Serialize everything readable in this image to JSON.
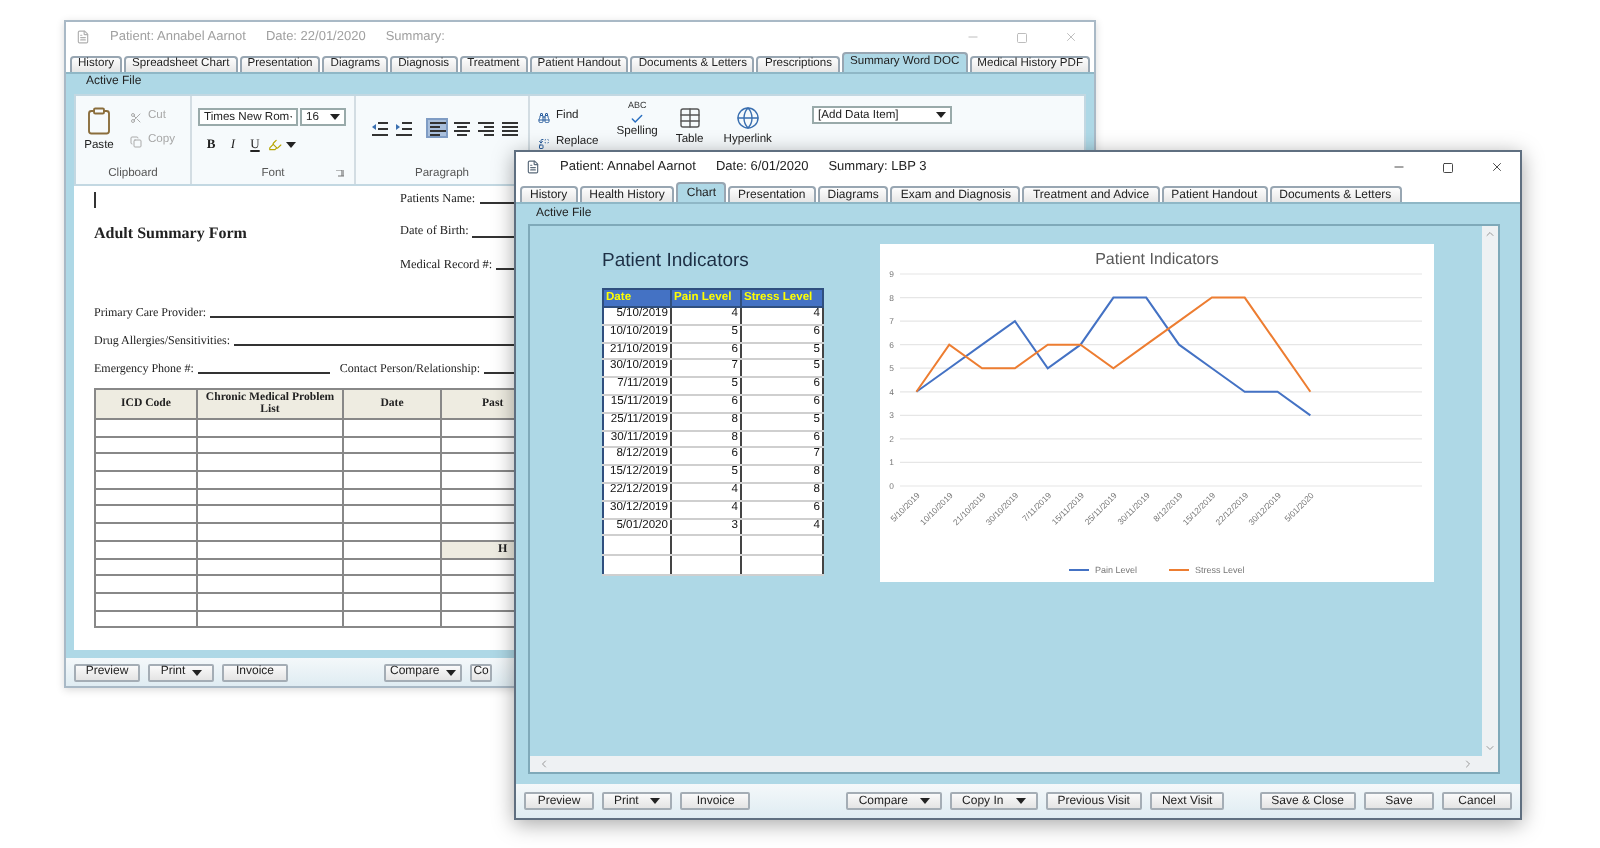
{
  "back_window": {
    "active": false,
    "title": [
      "Patient: Annabel Aarnot",
      "Date: 22/01/2020",
      "Summary:"
    ],
    "tabs": [
      {
        "label": "History",
        "selected": false
      },
      {
        "label": "Spreadsheet Chart",
        "selected": false
      },
      {
        "label": "Presentation",
        "selected": false
      },
      {
        "label": "Diagrams",
        "selected": false
      },
      {
        "label": "Diagnosis",
        "selected": false
      },
      {
        "label": "Treatment",
        "selected": false
      },
      {
        "label": "Patient Handout",
        "selected": false
      },
      {
        "label": "Documents & Letters",
        "selected": false
      },
      {
        "label": "Prescriptions",
        "selected": false
      },
      {
        "label": "Summary Word DOC",
        "selected": true
      },
      {
        "label": "Medical History PDF",
        "selected": false
      }
    ],
    "section_label": "Active File",
    "ribbon": {
      "clipboard": {
        "paste": "Paste",
        "cut": {
          "label": "Cut",
          "disabled": true
        },
        "copy": {
          "label": "Copy",
          "disabled": true
        },
        "group_label": "Clipboard"
      },
      "font": {
        "family": "Times New Rom",
        "size": "16",
        "bold": "B",
        "italic": "I",
        "underline": "U",
        "group_label": "Font"
      },
      "paragraph": {
        "alignments": [
          {
            "kind": "left",
            "selected": true
          },
          {
            "kind": "center",
            "selected": false
          },
          {
            "kind": "right",
            "selected": false
          },
          {
            "kind": "justify",
            "selected": false
          }
        ],
        "group_label": "Paragraph"
      },
      "find": "Find",
      "replace": "Replace",
      "spelling": {
        "mark": "ABC",
        "label": "Spelling"
      },
      "table": "Table",
      "hyperlink": "Hyperlink",
      "data_item": "[Add Data Item]"
    },
    "document": {
      "title": "Adult Summary Form",
      "header_fields": [
        "Patients Name:",
        "Date of Birth:",
        "Medical Record #:"
      ],
      "lines": [
        [
          "Primary Care Provider:"
        ],
        [
          "Drug Allergies/Sensitivities:"
        ],
        [
          "Emergency Phone #:",
          "Contact Person/Relationship:"
        ]
      ],
      "table": {
        "columns": [
          "ICD Code",
          "Chronic Medical Problem List",
          "Date",
          "Past"
        ],
        "section_row": "H"
      }
    },
    "buttons": {
      "left": [
        {
          "label": "Preview",
          "dropdown": false
        },
        {
          "label": "Print",
          "dropdown": true
        },
        {
          "label": "Invoice",
          "dropdown": false
        }
      ],
      "middle": [
        {
          "label": "Compare",
          "dropdown": true
        },
        {
          "label": "Co",
          "dropdown": false
        }
      ]
    }
  },
  "front_window": {
    "active": true,
    "title": [
      "Patient: Annabel Aarnot",
      "Date: 6/01/2020",
      "Summary: LBP 3"
    ],
    "tabs": [
      {
        "label": "History",
        "selected": false
      },
      {
        "label": "Health History",
        "selected": false
      },
      {
        "label": "Chart",
        "selected": true
      },
      {
        "label": "Presentation",
        "selected": false
      },
      {
        "label": "Diagrams",
        "selected": false
      },
      {
        "label": "Exam and Diagnosis",
        "selected": false
      },
      {
        "label": "Treatment and Advice",
        "selected": false
      },
      {
        "label": "Patient Handout",
        "selected": false
      },
      {
        "label": "Documents & Letters",
        "selected": false
      }
    ],
    "section_label": "Active File",
    "indicators": {
      "title": "Patient Indicators",
      "columns": [
        "Date",
        "Pain Level",
        "Stress Level"
      ],
      "rows": [
        [
          "5/10/2019",
          "4",
          "4"
        ],
        [
          "10/10/2019",
          "5",
          "6"
        ],
        [
          "21/10/2019",
          "6",
          "5"
        ],
        [
          "30/10/2019",
          "7",
          "5"
        ],
        [
          "7/11/2019",
          "5",
          "6"
        ],
        [
          "15/11/2019",
          "6",
          "6"
        ],
        [
          "25/11/2019",
          "8",
          "5"
        ],
        [
          "30/11/2019",
          "8",
          "6"
        ],
        [
          "8/12/2019",
          "6",
          "7"
        ],
        [
          "15/12/2019",
          "5",
          "8"
        ],
        [
          "22/12/2019",
          "4",
          "8"
        ],
        [
          "30/12/2019",
          "4",
          "6"
        ],
        [
          "5/01/2020",
          "3",
          "4"
        ]
      ]
    },
    "chart_data": {
      "type": "line",
      "title": "Patient Indicators",
      "categories": [
        "5/10/2019",
        "10/10/2019",
        "21/10/2019",
        "30/10/2019",
        "7/11/2019",
        "15/11/2019",
        "25/11/2019",
        "30/11/2019",
        "8/12/2019",
        "15/12/2019",
        "22/12/2019",
        "30/12/2019",
        "5/01/2020"
      ],
      "series": [
        {
          "name": "Pain Level",
          "color": "#4472c4",
          "values": [
            4,
            5,
            6,
            7,
            5,
            6,
            8,
            8,
            6,
            5,
            4,
            4,
            3
          ]
        },
        {
          "name": "Stress Level",
          "color": "#ed7d31",
          "values": [
            4,
            6,
            5,
            5,
            6,
            6,
            5,
            6,
            7,
            8,
            8,
            6,
            4
          ]
        }
      ],
      "ylim": [
        0,
        9
      ],
      "yticks": [
        0,
        1,
        2,
        3,
        4,
        5,
        6,
        7,
        8,
        9
      ],
      "grid": true,
      "legend": true
    },
    "buttons": {
      "left": [
        {
          "label": "Preview",
          "dropdown": false
        },
        {
          "label": "Print",
          "dropdown": true
        },
        {
          "label": "Invoice",
          "dropdown": false
        }
      ],
      "middle": [
        {
          "label": "Compare",
          "dropdown": true
        },
        {
          "label": "Copy In",
          "dropdown": true
        },
        {
          "label": "Previous Visit",
          "dropdown": false
        },
        {
          "label": "Next Visit",
          "dropdown": false
        }
      ],
      "right": [
        {
          "label": "Save & Close",
          "dropdown": false
        },
        {
          "label": "Save",
          "dropdown": false
        },
        {
          "label": "Cancel",
          "dropdown": false
        }
      ]
    }
  }
}
